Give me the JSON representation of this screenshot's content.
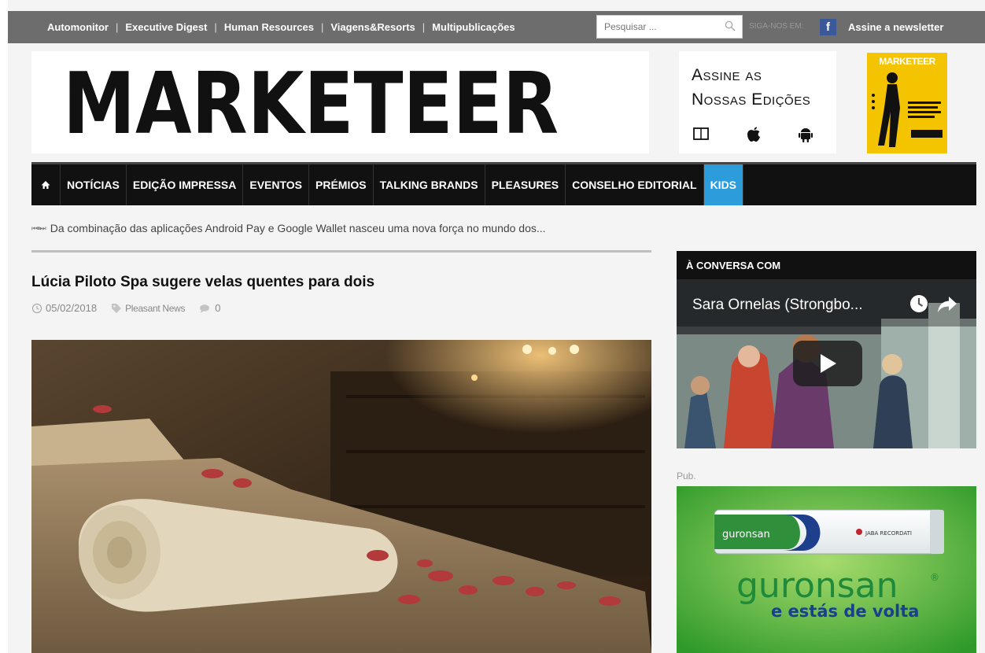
{
  "topbar": {
    "links": [
      "Automonitor",
      "Executive Digest",
      "Human Resources",
      "Viagens&Resorts",
      "Multipublicações"
    ],
    "search_placeholder": "Pesquisar ...",
    "follow_label": "SIGA-NOS EM:",
    "facebook_label": "f",
    "newsletter_label": "Assine a newsletter"
  },
  "header": {
    "logo": "MARKETEER",
    "promo_line1": "Assine as",
    "promo_line2": "Nossas Edições",
    "cover_masthead": "MARKETEER",
    "icons": [
      "book-icon",
      "apple-icon",
      "android-icon"
    ]
  },
  "nav": {
    "items": [
      "NOTÍCIAS",
      "EDIÇÃO IMPRESSA",
      "EVENTOS",
      "PRÉMIOS",
      "TALKING BRANDS",
      "PLEASURES",
      "CONSELHO EDITORIAL",
      "KIDS"
    ],
    "active": "KIDS",
    "active_color": "#2d9cdb"
  },
  "ticker": {
    "controls": "⏮⏸⏭",
    "text": "Da combinação das aplicações Android Pay e Google Wallet nasceu uma nova força no mundo dos..."
  },
  "article": {
    "title": "Lúcia Piloto Spa sugere velas quentes para dois",
    "date": "05/02/2018",
    "category": "Pleasant News",
    "comments": "0"
  },
  "sidebar": {
    "section_title": "À CONVERSA COM",
    "video_title": "Sara Ornelas (Strongbo...",
    "pub_label": "Pub.",
    "ad_brand": "guronsan",
    "ad_brand_small": "guronsan",
    "ad_registered": "®",
    "ad_tagline": "e estás de volta",
    "ad_company": "JABA RECORDATI"
  }
}
